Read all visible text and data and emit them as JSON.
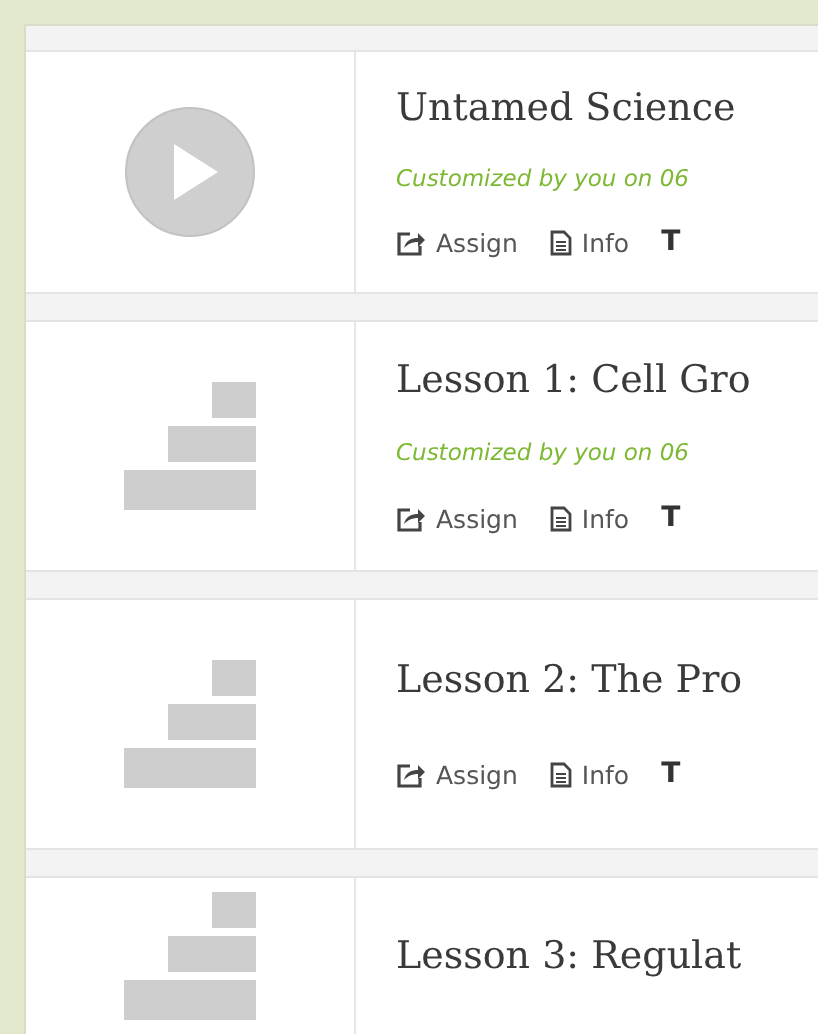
{
  "items": [
    {
      "kind": "video",
      "title": "Untamed Science",
      "subtitle": "Customized by you on 06",
      "actions": [
        {
          "kind": "assign",
          "label": "Assign"
        },
        {
          "kind": "info",
          "label": "Info"
        },
        {
          "kind": "cut",
          "label": "T"
        }
      ]
    },
    {
      "kind": "lesson",
      "title": "Lesson 1: Cell Gro",
      "subtitle": "Customized by you on 06",
      "actions": [
        {
          "kind": "assign",
          "label": "Assign"
        },
        {
          "kind": "info",
          "label": "Info"
        },
        {
          "kind": "cut",
          "label": "T"
        }
      ]
    },
    {
      "kind": "lesson",
      "title": "Lesson 2: The Pro",
      "actions": [
        {
          "kind": "assign",
          "label": "Assign"
        },
        {
          "kind": "info",
          "label": "Info"
        },
        {
          "kind": "cut",
          "label": "T"
        }
      ]
    },
    {
      "kind": "lesson",
      "title": "Lesson 3: Regulat"
    }
  ]
}
